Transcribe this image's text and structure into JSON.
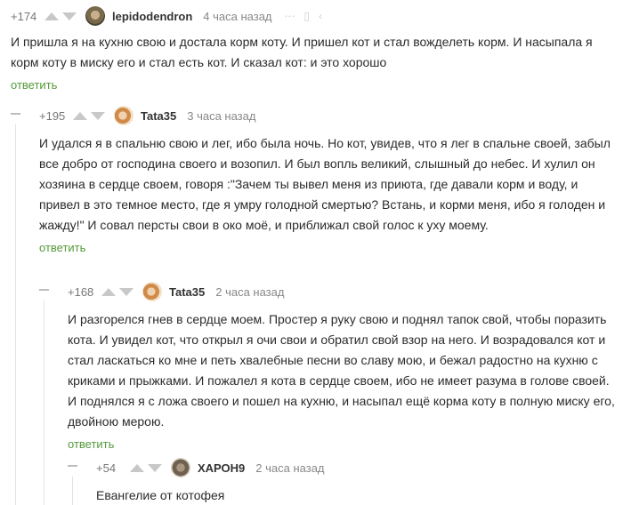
{
  "comments": [
    {
      "rating": "+174",
      "nick": "lepidodendron",
      "time": "4 часа назад",
      "text": "И пришла я на кухню свою и достала корм коту. И пришел кот и стал вожделеть корм. И насыпала я корм коту в миску его и стал есть кот. И сказал кот: и это хорошо",
      "reply": "ответить"
    },
    {
      "rating": "+195",
      "nick": "Tata35",
      "time": "3 часа назад",
      "text": "И удался я в спальню свою и лег, ибо была ночь. Но кот, увидев, что я лег в спальне своей, забыл все добро от господина своего и возопил. И был вопль великий, слышный до небес. И хулил он хозяина в сердце своем, говоря :\"Зачем ты вывел меня из приюта, где давали корм и воду, и привел в это темное место, где я умру голодной смертью? Встань, и корми меня, ибо я голоден и жажду!\"  И совал персты свои в око моё, и приближал свой голос к уху моему.",
      "reply": "ответить"
    },
    {
      "rating": "+168",
      "nick": "Tata35",
      "time": "2 часа назад",
      "text": "И разгорелся гнев в сердце моем. Простер я руку свою и поднял тапок свой, чтобы поразить кота. И увидел кот, что открыл я очи свои и обратил свой взор на него. И возрадовался кот и стал ласкаться ко мне и петь хвалебные песни во славу мою, и бежал радостно на кухню с криками и прыжками. И пожалел я кота в сердце своем, ибо не имеет разума в голове своей. И поднялся я с ложа своего и пошел на кухню, и насыпал ещё корма коту в полную миску его, двойною мерою.",
      "reply": "ответить"
    },
    {
      "rating": "+54",
      "nick": "ХАРОН9",
      "time": "2 часа назад",
      "text": "Евангелие от котофея"
    }
  ]
}
